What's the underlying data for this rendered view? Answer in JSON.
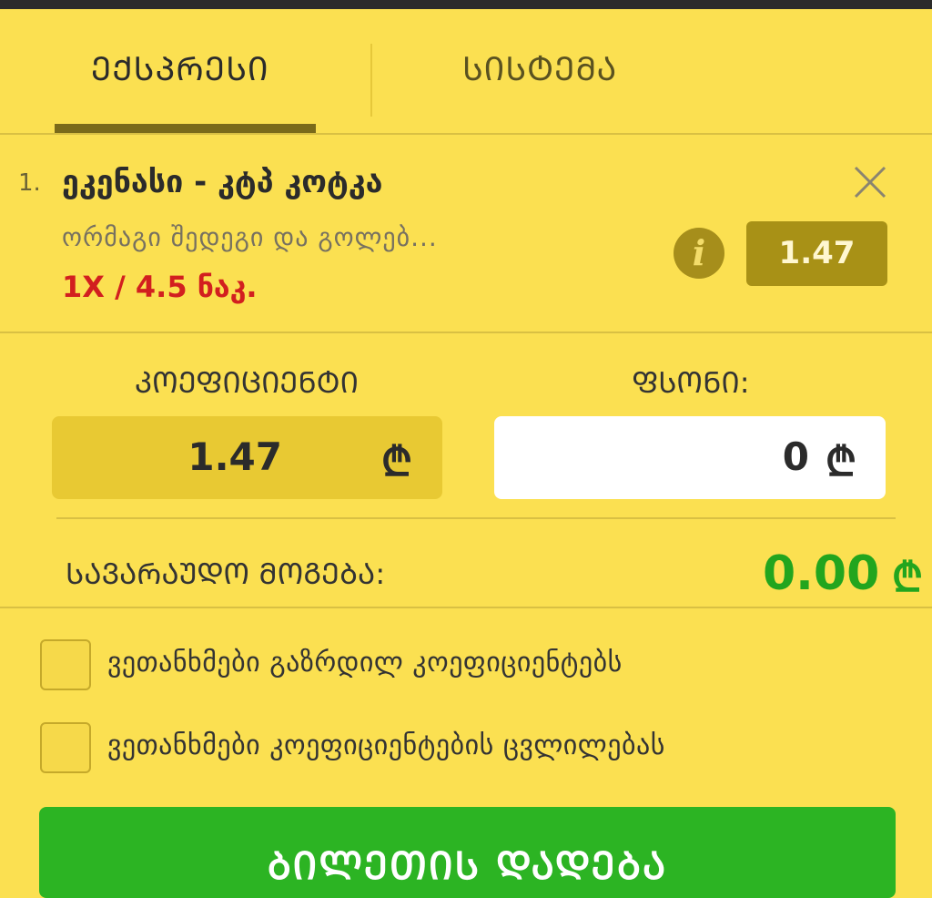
{
  "tabs": [
    {
      "label": "ᲔᲥᲡᲞᲠᲔᲡᲘ",
      "active": true
    },
    {
      "label": "ᲡᲘᲡᲢᲔᲛᲐ",
      "active": false
    }
  ],
  "bet": {
    "number": "1.",
    "title": "ეკენასი - კტპ კოტკა",
    "market": "ორმაგი შედეგი და გოლებ...",
    "pick": "1X / 4.5 ნაკ.",
    "odds": "1.47"
  },
  "coefficient": {
    "label": "ᲙᲝᲔᲤᲘᲪᲘᲔᲜᲢᲘ",
    "value": "1.47",
    "currency": "₾"
  },
  "stake": {
    "label": "ᲤᲡᲝᲜᲘ:",
    "value": "0",
    "currency": "₾"
  },
  "potential_win": {
    "label": "ᲡᲐᲕᲐᲠᲐᲣᲓᲝ ᲛᲝᲒᲔᲑᲐ:",
    "value": "0.00",
    "currency": "₾"
  },
  "options": [
    {
      "label": "ვეთანხმები გაზრდილ კოეფიციენტებს",
      "checked": false
    },
    {
      "label": "ვეთანხმები კოეფიციენტების ცვლილებას",
      "checked": false
    }
  ],
  "place_bet_label": "ᲑᲘᲚᲔᲗᲘᲡ ᲓᲐᲓᲔᲑᲐ",
  "colors": {
    "background": "#fbe051",
    "accent_dark": "#a89116",
    "win_green": "#22a51e",
    "button_green": "#2cb423",
    "pick_red": "#d21f1f"
  }
}
